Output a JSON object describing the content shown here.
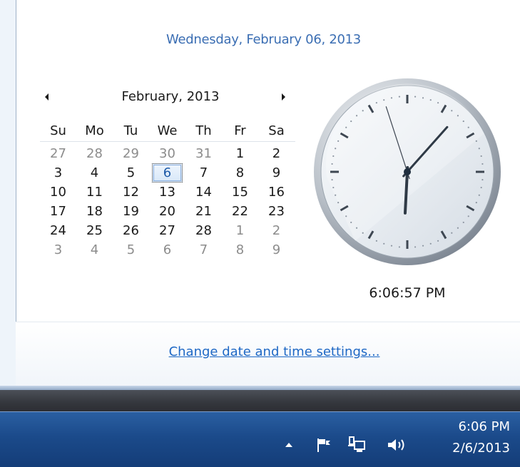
{
  "flyout": {
    "long_date": "Wednesday, February 06, 2013",
    "settings_link": "Change date and time settings..."
  },
  "calendar": {
    "month_title": "February, 2013",
    "prev_icon": "left-arrow-icon",
    "next_icon": "right-arrow-icon",
    "weekdays": [
      "Su",
      "Mo",
      "Tu",
      "We",
      "Th",
      "Fr",
      "Sa"
    ],
    "weeks": [
      [
        "27",
        "28",
        "29",
        "30",
        "31",
        "1",
        "2"
      ],
      [
        "3",
        "4",
        "5",
        "6",
        "7",
        "8",
        "9"
      ],
      [
        "10",
        "11",
        "12",
        "13",
        "14",
        "15",
        "16"
      ],
      [
        "17",
        "18",
        "19",
        "20",
        "21",
        "22",
        "23"
      ],
      [
        "24",
        "25",
        "26",
        "27",
        "28",
        "1",
        "2"
      ],
      [
        "3",
        "4",
        "5",
        "6",
        "7",
        "8",
        "9"
      ]
    ],
    "other_month": [
      [
        true,
        true,
        true,
        true,
        true,
        false,
        false
      ],
      [
        false,
        false,
        false,
        false,
        false,
        false,
        false
      ],
      [
        false,
        false,
        false,
        false,
        false,
        false,
        false
      ],
      [
        false,
        false,
        false,
        false,
        false,
        false,
        false
      ],
      [
        false,
        false,
        false,
        false,
        false,
        true,
        true
      ],
      [
        true,
        true,
        true,
        true,
        true,
        true,
        true
      ]
    ],
    "today": {
      "week": 1,
      "day": 3
    }
  },
  "clock": {
    "time_text": "6:06:57 PM",
    "hours": 6,
    "minutes": 6,
    "seconds": 57
  },
  "taskbar": {
    "time": "6:06 PM",
    "date": "2/6/2013",
    "icons": [
      "show-hidden-icons-arrow-icon",
      "action-center-flag-icon",
      "network-icon",
      "volume-icon"
    ]
  },
  "colors": {
    "accent": "#3b6eb3",
    "link": "#1e68c5",
    "taskbar": "#1b4a8a"
  }
}
